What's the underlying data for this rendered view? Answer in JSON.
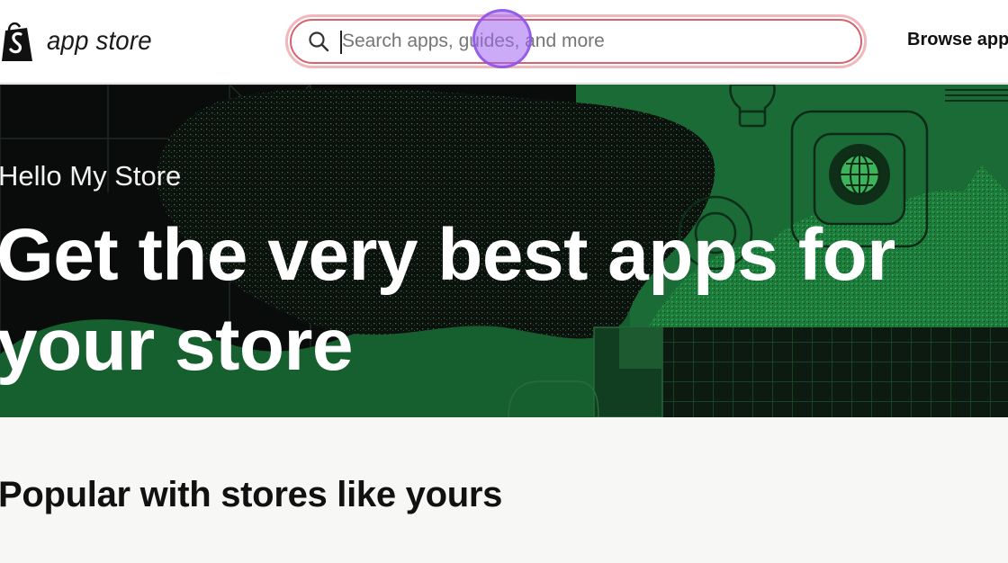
{
  "header": {
    "logo_text": "app store",
    "search": {
      "placeholder": "Search apps, guides, and more"
    },
    "browse_label": "Browse apps"
  },
  "hero": {
    "greeting": "Hello My Store",
    "title": "Get the very best apps for your store"
  },
  "sections": {
    "popular_title": "Popular with stores like yours"
  },
  "colors": {
    "accent_green": "#2e9b4a",
    "hero_bg": "#0b0d0c",
    "search_border": "#d9616c",
    "cursor": "#a064f0"
  }
}
